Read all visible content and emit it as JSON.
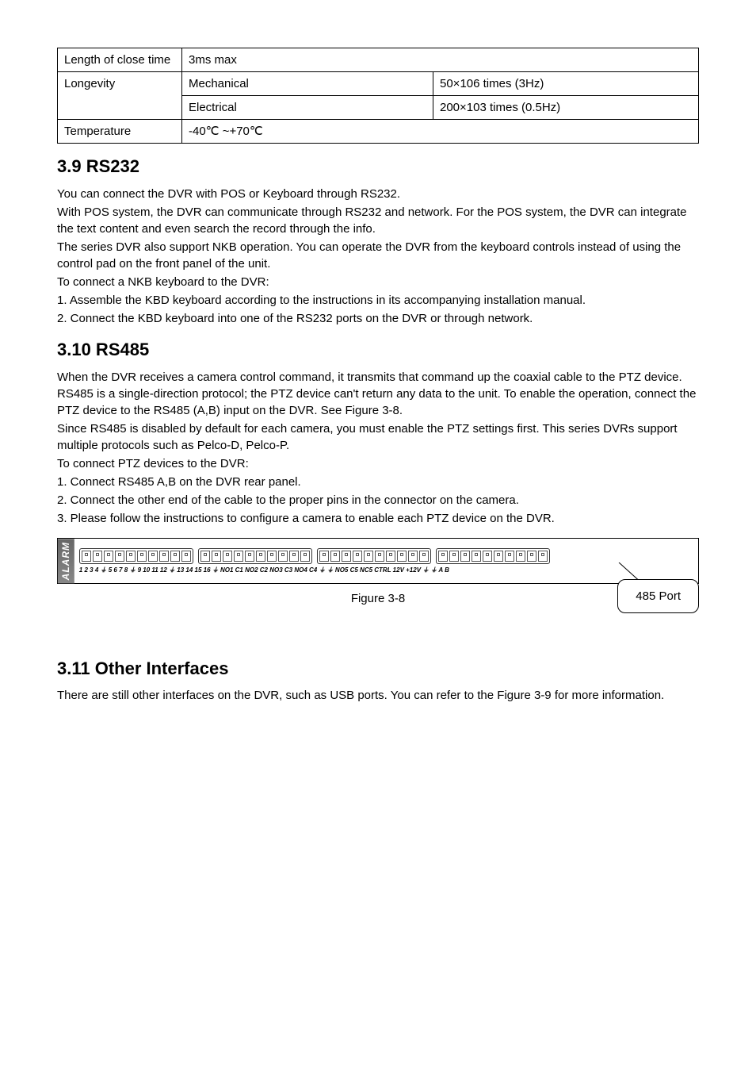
{
  "table": {
    "r1c1": "Length of close time",
    "r1c2": "3ms max",
    "r2c1": "Longevity",
    "r2c2a": "Mechanical",
    "r2c2b": "50×106 times (3Hz)",
    "r3c2a": "Electrical",
    "r3c2b": "200×103 times (0.5Hz)",
    "r4c1": "Temperature",
    "r4c2": "-40℃ ~+70℃"
  },
  "s39": {
    "heading": "3.9  RS232",
    "p1": "You can connect the DVR with POS or Keyboard through RS232.",
    "p2": "With POS system, the DVR can communicate through RS232 and network. For the POS system, the DVR can integrate the text content and even search the record through the info.",
    "p3": "The series DVR also support NKB operation. You can operate the DVR from the keyboard controls instead of using the control pad on the front panel of the unit.",
    "p4": "To connect a NKB keyboard to the DVR:",
    "p5": "1. Assemble the KBD keyboard according to the instructions in its accompanying installation manual.",
    "p6": "2. Connect the KBD keyboard into one of the RS232 ports on the DVR or through network."
  },
  "s310": {
    "heading": "3.10 RS485",
    "p1": "When the DVR receives a camera control command, it transmits that command up the coaxial cable to the PTZ device. RS485 is a single-direction protocol; the PTZ device can't return any data to the unit. To enable the operation, connect the PTZ device to the RS485 (A,B) input on the DVR. See Figure 3-8.",
    "p2": "Since RS485 is disabled by default for each camera, you must enable the PTZ settings first. This series DVRs support multiple protocols such as Pelco-D, Pelco-P.",
    "p3": "To connect PTZ devices to the DVR:",
    "p4": "1. Connect RS485 A,B  on the DVR rear panel.",
    "p5": "2. Connect the other end of the cable to the proper pins in the connector on the camera.",
    "p6": "3. Please follow the instructions to configure a camera to enable each PTZ device on the DVR."
  },
  "figure": {
    "alarm_label": "ALARM",
    "terminal_labels": "1  2  3  4  ⏚  5  6  7  8  ⏚     9  10 11 12 ⏚  13 14 15 16 ⏚     NO1 C1 NO2 C2 NO3 C3 NO4 C4 ⏚  ⏚     NO5 C5 NC5 CTRL 12V  +12V  ⏚  ⏚  A  B",
    "caption": "Figure 3-8",
    "callout": "485 Port"
  },
  "s311": {
    "heading": "3.11 Other Interfaces",
    "p1": "There are still other interfaces on the DVR, such as USB ports. You can refer to the Figure 3-9 for more information."
  }
}
